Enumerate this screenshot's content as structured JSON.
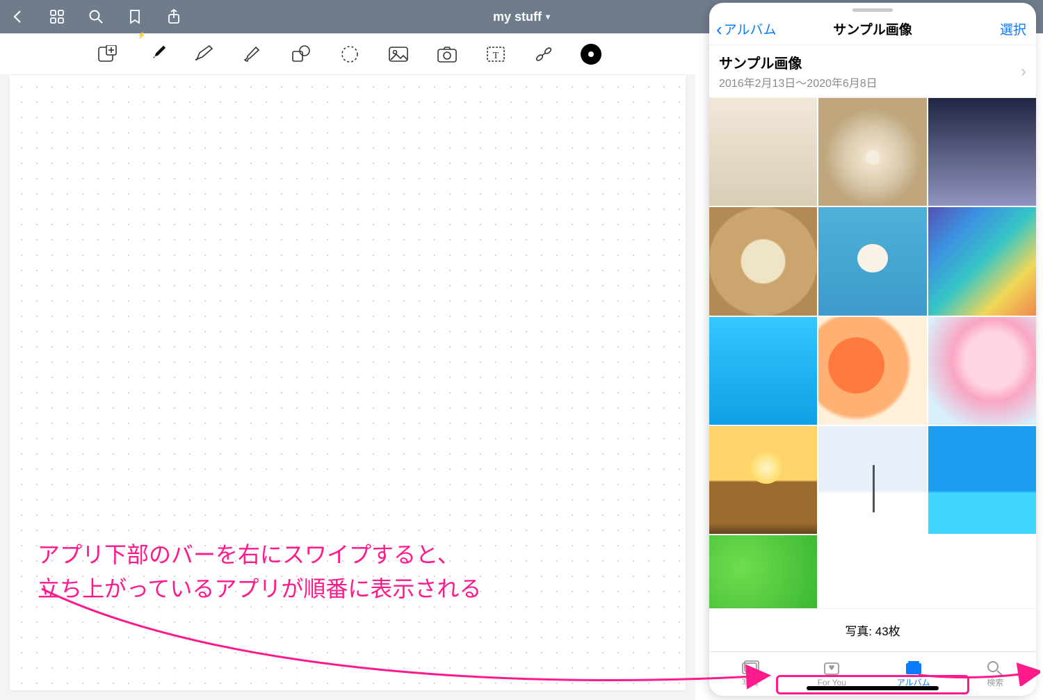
{
  "topbar": {
    "title": "my stuff"
  },
  "tools": {
    "items": [
      "insert",
      "pen",
      "highlighter",
      "brush",
      "shapes",
      "lasso",
      "image",
      "camera",
      "text",
      "link"
    ],
    "color": "#000000"
  },
  "photo_panel": {
    "back_label": "アルバム",
    "title": "サンプル画像",
    "select_label": "選択",
    "album_name": "サンプル画像",
    "album_dates": "2016年2月13日～2020年6月8日",
    "count_label": "写真: 43枚",
    "tabs": {
      "photos": "写真",
      "foryou": "For You",
      "albums": "アルバム",
      "search": "検索"
    }
  },
  "annotation": {
    "line1": "アプリ下部のバーを右にスワイプすると、",
    "line2": "立ち上がっているアプリが順番に表示される"
  }
}
